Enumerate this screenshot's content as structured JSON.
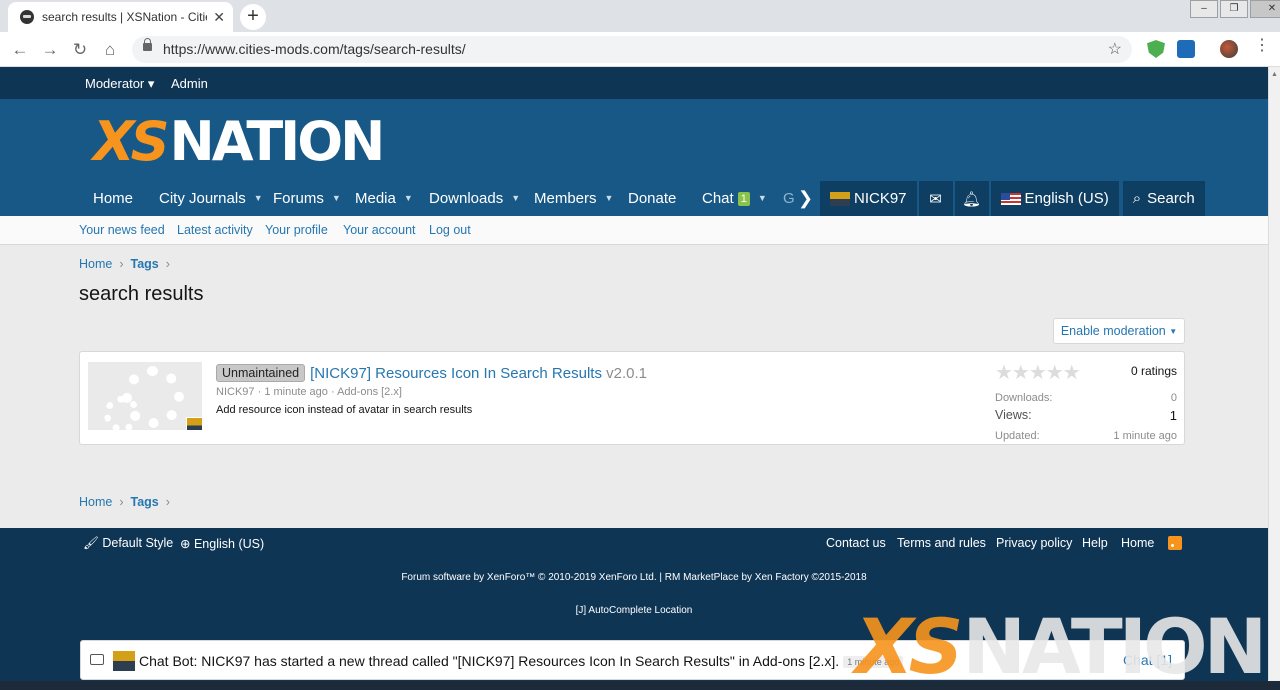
{
  "browser": {
    "tab_title": "search results | XSNation - Cities",
    "tab_close": "✕",
    "new_tab": "+",
    "url": "https://www.cities-mods.com/tags/search-results/"
  },
  "modbar": {
    "moderator": "Moderator ▾",
    "admin": "Admin"
  },
  "logo": {
    "xs": "XS",
    "nation": "NATION"
  },
  "nav": {
    "home": "Home",
    "city_journals": "City Journals",
    "forums": "Forums",
    "media": "Media",
    "downloads": "Downloads",
    "members": "Members",
    "donate": "Donate",
    "chat": "Chat",
    "chat_badge": "1",
    "g": "G",
    "user": "NICK97",
    "language": "English (US)",
    "search": "Search"
  },
  "subnav": {
    "news_feed": "Your news feed",
    "latest_activity": "Latest activity",
    "profile": "Your profile",
    "account": "Your account",
    "logout": "Log out"
  },
  "breadcrumb": {
    "home": "Home",
    "tags": "Tags"
  },
  "page_title": "search results",
  "enable_moderation": "Enable moderation",
  "result": {
    "label": "Unmaintained",
    "title": "[NICK97] Resources Icon In Search Results",
    "version": "v2.0.1",
    "author": "NICK97",
    "time": "1 minute ago",
    "category": "Add-ons [2.x]",
    "description": "Add resource icon instead of avatar in search results",
    "ratings": "0 ratings",
    "downloads_label": "Downloads:",
    "downloads": "0",
    "views_label": "Views:",
    "views": "1",
    "updated_label": "Updated:",
    "updated": "1 minute ago"
  },
  "footer": {
    "style": "Default Style",
    "language": "English (US)",
    "contact": "Contact us",
    "terms": "Terms and rules",
    "privacy": "Privacy policy",
    "help": "Help",
    "home": "Home",
    "copyright": "Forum software by XenForo™ © 2010-2019 XenForo Ltd. | RM MarketPlace by Xen Factory ©2015-2018",
    "autocomplete": "[J] AutoComplete Location"
  },
  "chat": {
    "message": "Chat Bot: NICK97 has started a new thread called \"[NICK97] Resources Icon In Search Results\" in Add-ons [2.x].",
    "ago": "1 minute ago",
    "button": "Chat [1]"
  },
  "colors": {
    "header_blue": "#185886",
    "dark_blue": "#0f3554",
    "link_blue": "#2577b1",
    "brand_orange": "#f7941d"
  }
}
